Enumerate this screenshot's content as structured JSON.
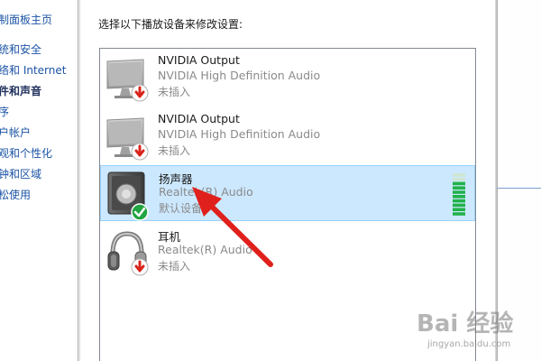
{
  "left_nav": {
    "items": [
      {
        "label": "制面板主页",
        "active": false
      },
      {
        "label": "统和安全",
        "active": false
      },
      {
        "label": "络和 Internet",
        "active": false
      },
      {
        "label": "件和声音",
        "active": true
      },
      {
        "label": "序",
        "active": false
      },
      {
        "label": "户帐户",
        "active": false
      },
      {
        "label": "观和个性化",
        "active": false
      },
      {
        "label": "钟和区域",
        "active": false
      },
      {
        "label": "松使用",
        "active": false
      }
    ]
  },
  "dialog": {
    "instruction": "选择以下播放设备来修改设置:"
  },
  "devices": [
    {
      "name": "NVIDIA Output",
      "description": "NVIDIA High Definition Audio",
      "status": "未插入",
      "icon": "monitor-icon",
      "badge": "red-down-arrow-badge",
      "selected": false
    },
    {
      "name": "NVIDIA Output",
      "description": "NVIDIA High Definition Audio",
      "status": "未插入",
      "icon": "monitor-icon",
      "badge": "red-down-arrow-badge",
      "selected": false
    },
    {
      "name": "扬声器",
      "description": "Realtek(R) Audio",
      "status": "默认设备",
      "icon": "speaker-icon",
      "badge": "green-check-badge",
      "selected": true,
      "level_fraction": 0.8
    },
    {
      "name": "耳机",
      "description": "Realtek(R) Audio",
      "status": "未插入",
      "icon": "headphones-icon",
      "badge": "red-down-arrow-badge",
      "selected": false
    }
  ],
  "colors": {
    "selection_bg": "#cce8ff",
    "selection_border": "#99d1ff",
    "arrow": "#e0201c",
    "meter_green": "#21b24a",
    "link": "#1c54a6"
  },
  "watermark": {
    "brand": "Bai 经验",
    "url": "jingyan.baidu.com"
  }
}
